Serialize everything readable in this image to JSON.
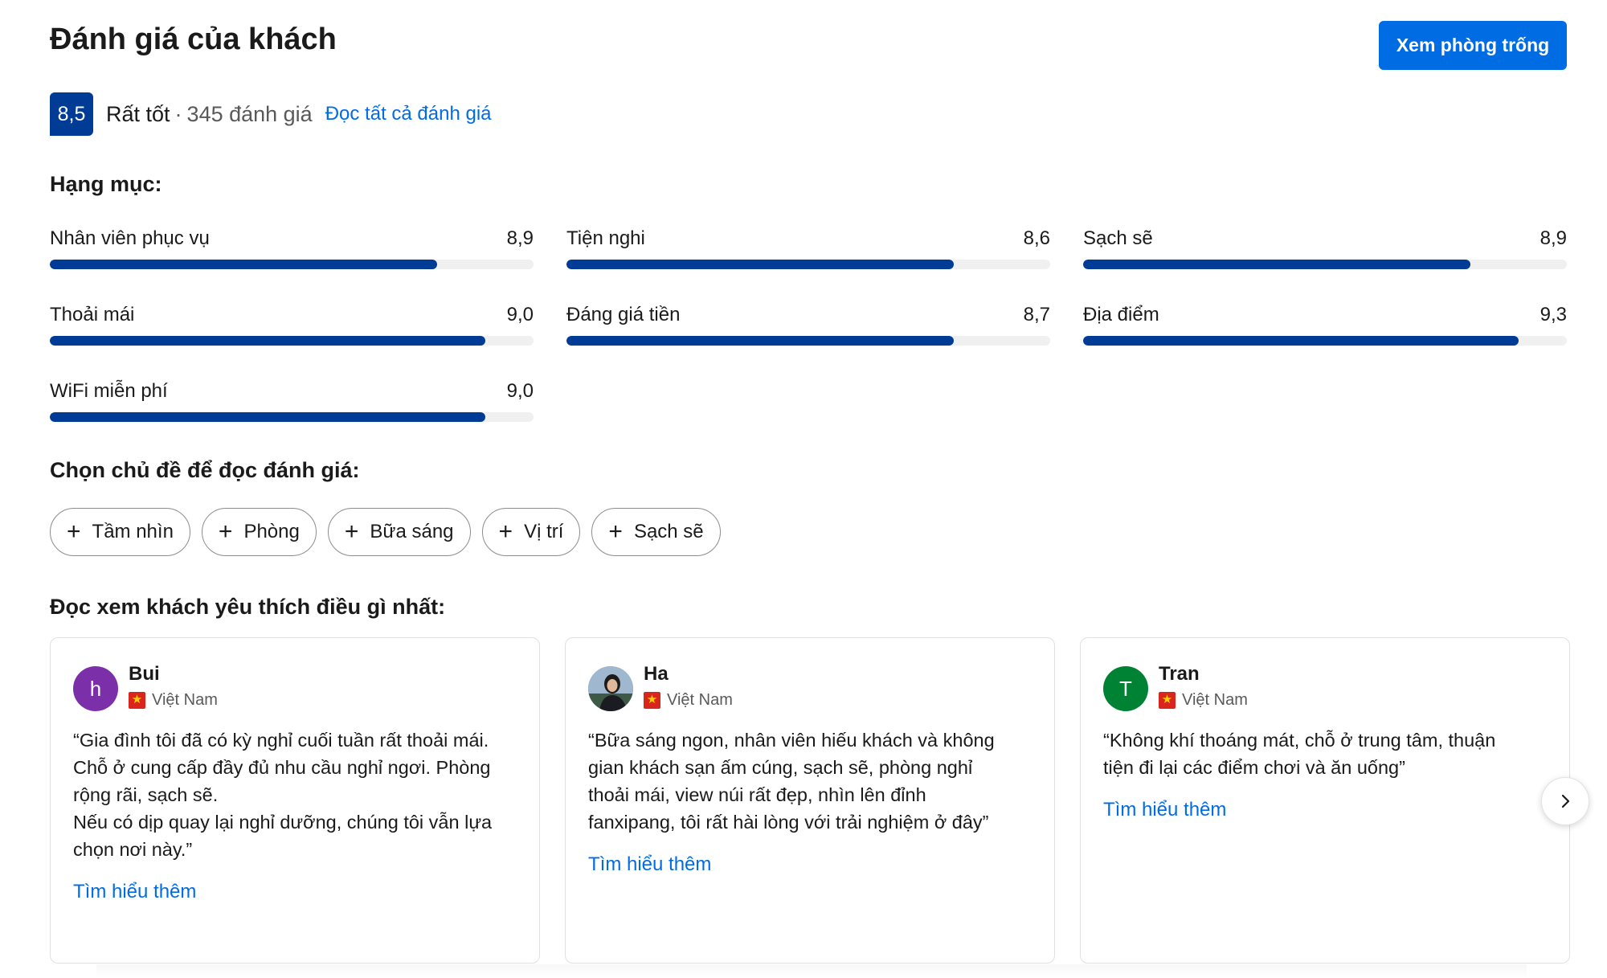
{
  "header": {
    "title": "Đánh giá của khách",
    "cta_label": "Xem phòng trống"
  },
  "score": {
    "value": "8,5",
    "word": "Rất tốt",
    "separator": "·",
    "count": "345 đánh giá",
    "read_all": "Đọc tất cả đánh giá"
  },
  "categories": {
    "heading": "Hạng mục:",
    "items": [
      {
        "label": "Nhân viên phục vụ",
        "score": "8,9",
        "fill": 0.8
      },
      {
        "label": "Tiện nghi",
        "score": "8,6",
        "fill": 0.8
      },
      {
        "label": "Sạch sẽ",
        "score": "8,9",
        "fill": 0.8
      },
      {
        "label": "Thoải mái",
        "score": "9,0",
        "fill": 0.9
      },
      {
        "label": "Đáng giá tiền",
        "score": "8,7",
        "fill": 0.8
      },
      {
        "label": "Địa điểm",
        "score": "9,3",
        "fill": 0.9
      },
      {
        "label": "WiFi miễn phí",
        "score": "9,0",
        "fill": 0.9
      }
    ]
  },
  "topics": {
    "heading": "Chọn chủ đề để đọc đánh giá:",
    "plus_icon": "plus-icon",
    "chips": [
      "Tầm nhìn",
      "Phòng",
      "Bữa sáng",
      "Vị trí",
      "Sạch sẽ"
    ]
  },
  "highlights": {
    "heading": "Đọc xem khách yêu thích điều gì nhất:",
    "reviews": [
      {
        "avatar_letter": "h",
        "avatar_color": "#7b2fa8",
        "name": "Bui",
        "country": "Việt Nam",
        "text": "“Gia đình tôi đã có kỳ nghỉ cuối tuần rất thoải mái.\nChỗ ở cung cấp đầy đủ nhu cầu nghỉ ngơi. Phòng\nrộng rãi, sạch sẽ.\nNếu có dịp quay lại nghỉ dưỡng, chúng tôi vẫn lựa\nchọn nơi này.”",
        "more": "Tìm hiểu thêm"
      },
      {
        "avatar_letter": "",
        "avatar_color": "#8aa7c2",
        "name": "Ha",
        "country": "Việt Nam",
        "text": "“Bữa sáng ngon, nhân viên hiếu khách và không\ngian khách sạn ấm cúng, sạch sẽ, phòng nghỉ\nthoải mái, view núi rất đẹp, nhìn lên đỉnh\nfanxipang, tôi rất hài lòng với trải nghiệm ở đây”",
        "more": "Tìm hiểu thêm"
      },
      {
        "avatar_letter": "T",
        "avatar_color": "#008234",
        "name": "Tran",
        "country": "Việt Nam",
        "text": "“Không khí thoáng mát, chỗ ở trung tâm, thuận\ntiện đi lại các điểm chơi và ăn uống”",
        "more": "Tìm hiểu thêm"
      }
    ],
    "next_icon": "chevron-right-icon"
  },
  "colors": {
    "brand_blue": "#003b95",
    "link_blue": "#006ce4",
    "flag_red": "#da251d",
    "flag_star": "#ffcd00"
  }
}
